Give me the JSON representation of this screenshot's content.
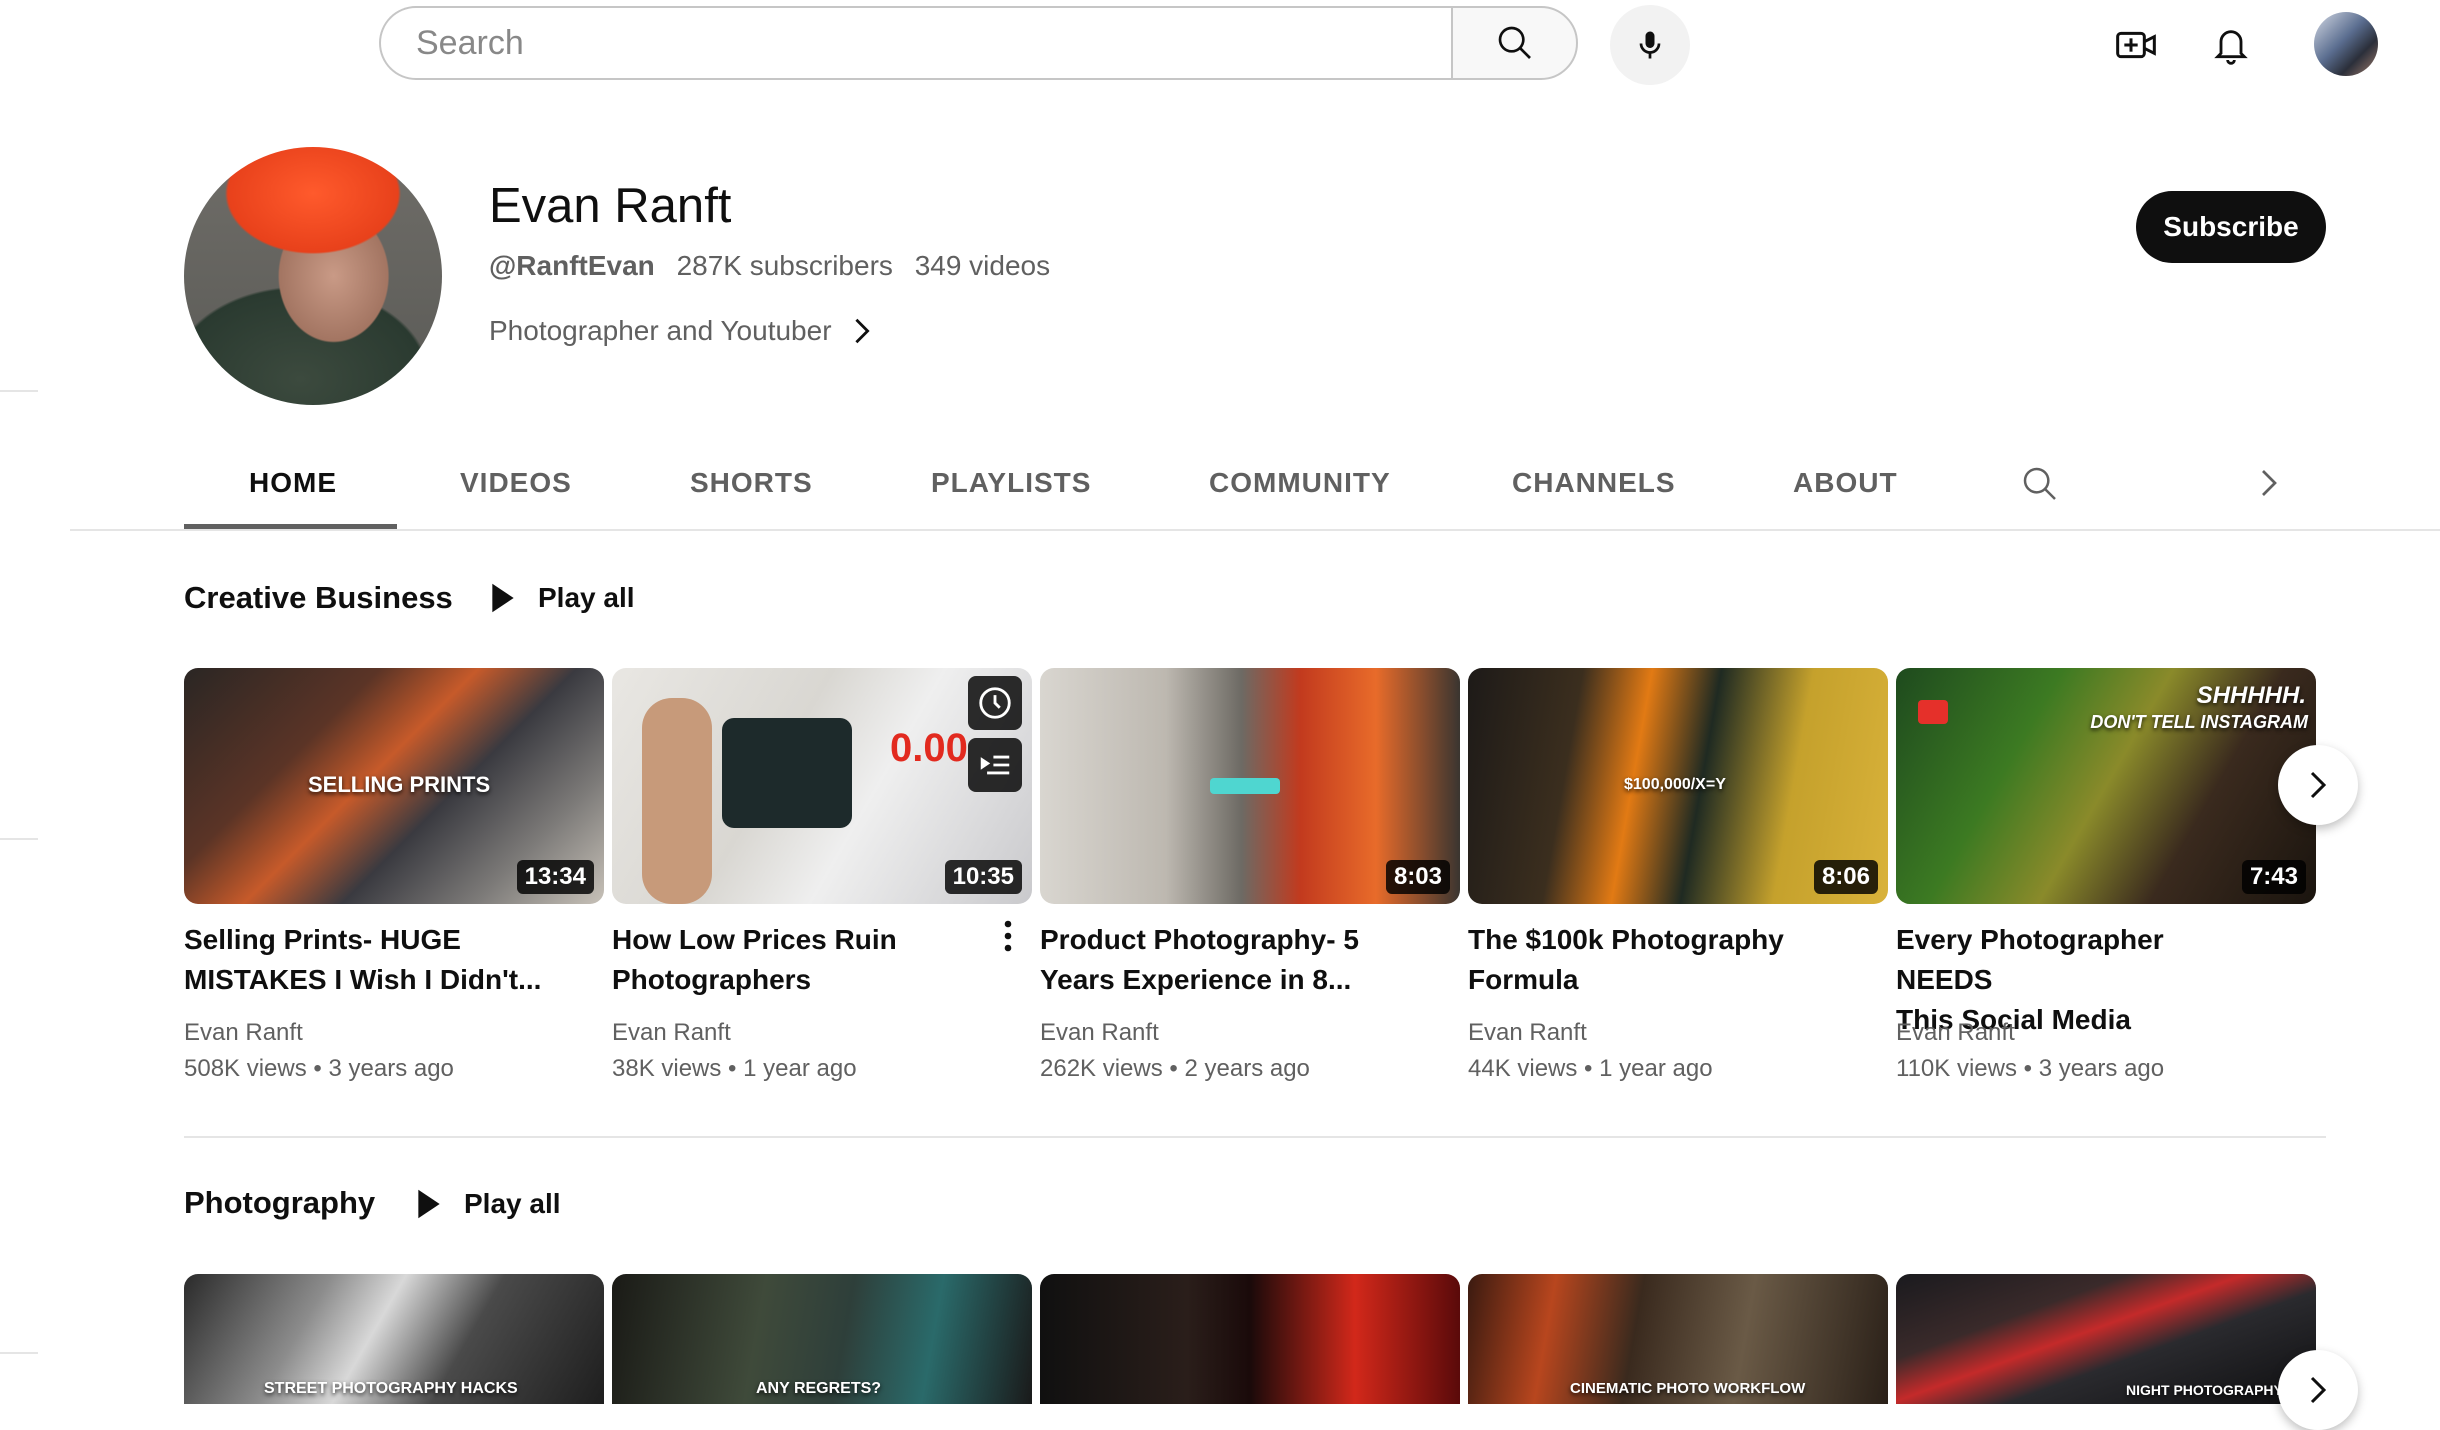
{
  "topbar": {
    "search_placeholder": "Search",
    "icons": [
      "search-icon",
      "mic-icon",
      "create-video-icon",
      "bell-icon",
      "user-avatar"
    ]
  },
  "channel": {
    "name": "Evan Ranft",
    "handle": "@RanftEvan",
    "subscribers": "287K subscribers",
    "videos": "349 videos",
    "description": "Photographer and Youtuber",
    "subscribe_label": "Subscribe"
  },
  "tabs": [
    {
      "label": "HOME",
      "active": true
    },
    {
      "label": "VIDEOS"
    },
    {
      "label": "SHORTS"
    },
    {
      "label": "PLAYLISTS"
    },
    {
      "label": "COMMUNITY"
    },
    {
      "label": "CHANNELS"
    },
    {
      "label": "ABOUT"
    }
  ],
  "shelves": [
    {
      "title": "Creative Business",
      "play_all": "Play all",
      "videos": [
        {
          "title_l1": "Selling Prints- HUGE",
          "title_l2": "MISTAKES I Wish I Didn't...",
          "channel": "Evan Ranft",
          "views": "508K views",
          "age": "3 years ago",
          "duration": "13:34",
          "overlay": "SELLING PRINTS"
        },
        {
          "title_l1": "How Low Prices Ruin",
          "title_l2": "Photographers",
          "channel": "Evan Ranft",
          "views": "38K views",
          "age": "1 year ago",
          "duration": "10:35",
          "overlay": "0.00"
        },
        {
          "title_l1": "Product Photography- 5",
          "title_l2": "Years Experience in 8...",
          "channel": "Evan Ranft",
          "views": "262K views",
          "age": "2 years ago",
          "duration": "8:03",
          "overlay": ""
        },
        {
          "title_l1": "The $100k Photography",
          "title_l2": "Formula",
          "channel": "Evan Ranft",
          "views": "44K views",
          "age": "1 year ago",
          "duration": "8:06",
          "overlay": "$100,000/X=Y"
        },
        {
          "title_l1": "Every Photographer NEEDS",
          "title_l2": "This Social Media",
          "channel": "Evan Ranft",
          "views": "110K views",
          "age": "3 years ago",
          "duration": "7:43",
          "overlay": "SHHHHH.",
          "overlay2": "DON'T TELL INSTAGRAM"
        }
      ]
    },
    {
      "title": "Photography",
      "play_all": "Play all",
      "videos": [
        {
          "overlay": "STREET PHOTOGRAPHY HACKS"
        },
        {
          "overlay": "ANY REGRETS?"
        },
        {
          "overlay": ""
        },
        {
          "overlay": "CINEMATIC PHOTO WORKFLOW"
        },
        {
          "overlay": "NIGHT PHOTOGRAPHY"
        }
      ]
    }
  ],
  "colors": {
    "brand_black": "#0f0f0f",
    "secondary_text": "#606060",
    "divider": "#e5e5e5"
  }
}
